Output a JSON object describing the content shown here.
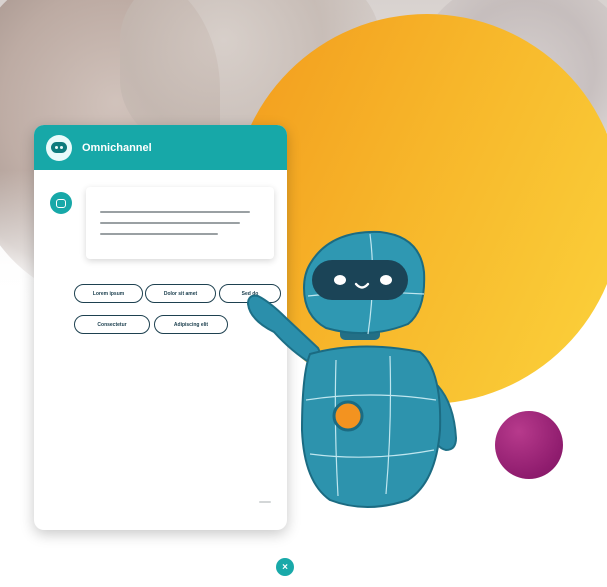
{
  "colors": {
    "teal": "#17a8a8",
    "navy": "#1e4150",
    "orange": "#f29b1d",
    "yellow": "#fbd33c",
    "plum": "#8f1c6e"
  },
  "chat": {
    "title": "Omnichannel",
    "header_icon": "bot-icon",
    "bot_avatar_icon": "chat-icon",
    "quick_replies": [
      "Lorem ipsum",
      "Dolor sit amet",
      "Sed do",
      "Consectetur",
      "Adipiscing elit"
    ]
  },
  "close_button": {
    "icon": "close-icon",
    "label": "×"
  }
}
